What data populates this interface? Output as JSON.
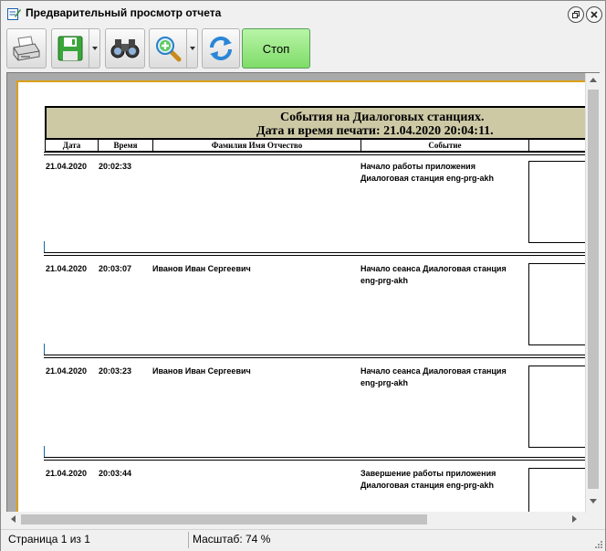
{
  "window": {
    "title": "Предварительный просмотр отчета"
  },
  "toolbar": {
    "print_icon": "printer-icon",
    "save_icon": "save-icon",
    "find_icon": "binoculars-icon",
    "zoom_icon": "zoom-in-icon",
    "refresh_icon": "refresh-icon",
    "stop_label": "Стоп"
  },
  "report": {
    "title": "События на Диалоговых станциях.",
    "printed_at": "Дата и время печати: 21.04.2020 20:04:11.",
    "columns": [
      "Дата",
      "Время",
      "Фамилия Имя Отчество",
      "Событие"
    ],
    "rows": [
      {
        "date": "21.04.2020",
        "time": "20:02:33",
        "name": "",
        "event_line1": "Начало работы приложения",
        "event_line2": "Диалоговая станция  eng-prg-akh"
      },
      {
        "date": "21.04.2020",
        "time": "20:03:07",
        "name": "Иванов Иван Сергеевич",
        "event_line1": "Начало сеанса Диалоговая станция",
        "event_line2": "eng-prg-akh"
      },
      {
        "date": "21.04.2020",
        "time": "20:03:23",
        "name": "Иванов Иван Сергеевич",
        "event_line1": "Начало сеанса Диалоговая станция",
        "event_line2": "eng-prg-akh"
      },
      {
        "date": "21.04.2020",
        "time": "20:03:44",
        "name": "",
        "event_line1": "Завершение работы приложения",
        "event_line2": "Диалоговая станция  eng-prg-akh"
      }
    ]
  },
  "status": {
    "page": "Страница 1 из 1",
    "zoom": "Масштаб: 74 %"
  },
  "colors": {
    "header_band": "#cdc9a5",
    "page_border": "#d9a01a",
    "stop_button": "#8fe07a"
  }
}
